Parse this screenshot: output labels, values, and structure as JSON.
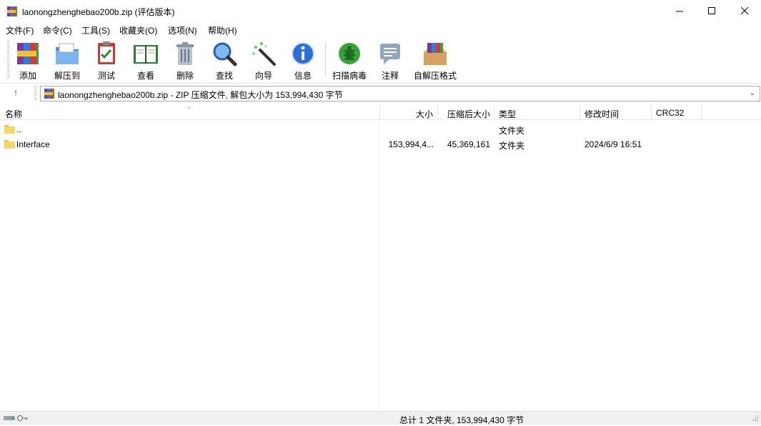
{
  "window": {
    "title": "laonongzhenghebao200b.zip (评估版本)",
    "minimize_glyph": "—",
    "maximize_glyph": "☐",
    "close_glyph": "✕"
  },
  "menu": [
    "文件(F)",
    "命令(C)",
    "工具(S)",
    "收藏夹(O)",
    "选项(N)",
    "帮助(H)"
  ],
  "toolbar": [
    {
      "label": "添加",
      "icon": "add-archive-icon"
    },
    {
      "label": "解压到",
      "icon": "extract-to-icon"
    },
    {
      "label": "测试",
      "icon": "test-icon"
    },
    {
      "label": "查看",
      "icon": "view-book-icon"
    },
    {
      "label": "删除",
      "icon": "trash-icon"
    },
    {
      "label": "查找",
      "icon": "magnifier-icon"
    },
    {
      "label": "向导",
      "icon": "wizard-wand-icon"
    },
    {
      "label": "信息",
      "icon": "info-icon"
    },
    {
      "label": "扫描病毒",
      "icon": "virus-scan-icon"
    },
    {
      "label": "注释",
      "icon": "comment-icon"
    },
    {
      "label": "自解压格式",
      "icon": "sfx-box-icon"
    }
  ],
  "address": {
    "up_glyph": "↑",
    "text": "laonongzhenghebao200b.zip - ZIP 压缩文件, 解包大小为 153,994,430 字节",
    "dropdown_glyph": "⌄"
  },
  "columns": {
    "name": "名称",
    "size": "大小",
    "packed": "压缩后大小",
    "type": "类型",
    "modified": "修改时间",
    "crc": "CRC32",
    "sort_glyph": "⌄"
  },
  "rows": [
    {
      "name": "..",
      "size": "",
      "packed": "",
      "type": "文件夹",
      "modified": "",
      "crc": ""
    },
    {
      "name": "Interface",
      "size": "153,994,4...",
      "packed": "45,369,161",
      "type": "文件夹",
      "modified": "2024/6/9 16:51",
      "crc": ""
    }
  ],
  "status": {
    "text": "总计 1 文件夹, 153,994,430 字节"
  },
  "colors": {
    "accent_green": "#3aa23a",
    "folder_yellow": "#f5d46a",
    "info_blue": "#2a6fd6"
  }
}
